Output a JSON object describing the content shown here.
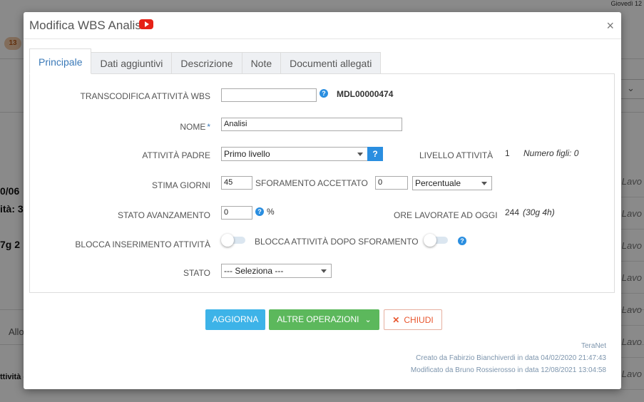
{
  "background": {
    "date_fragment": "Giovedì 12",
    "badge": "13",
    "text_fragments": [
      "0/06",
      "ità: 3",
      "7g 2",
      "Allo",
      "ttività e"
    ],
    "right_rows": [
      "S Lavo",
      "S Lavo",
      "S Lavo",
      "S Lavo",
      "S Lavo",
      "S Lavo",
      "S Lavo"
    ]
  },
  "modal": {
    "title": "Modifica WBS Analisi",
    "close_symbol": "×",
    "tabs": [
      {
        "label": "Principale",
        "active": true
      },
      {
        "label": "Dati aggiuntivi",
        "active": false
      },
      {
        "label": "Descrizione",
        "active": false
      },
      {
        "label": "Note",
        "active": false
      },
      {
        "label": "Documenti allegati",
        "active": false
      }
    ],
    "form": {
      "transcodifica_label": "TRANSCODIFICA ATTIVITÀ WBS",
      "transcodifica_value": "",
      "code": "MDL00000474",
      "nome_label": "NOME",
      "required_mark": "*",
      "nome_value": "Analisi",
      "attivita_padre_label": "ATTIVITÀ PADRE",
      "attivita_padre_value": "Primo livello",
      "help_btn_symbol": "?",
      "livello_label": "LIVELLO ATTIVITÀ",
      "livello_value": "1",
      "numero_figli": "Numero figli: 0",
      "stima_giorni_label": "STIMA GIORNI",
      "stima_giorni_value": "45",
      "sforamento_label": "SFORAMENTO ACCETTATO",
      "sforamento_value": "0",
      "sforamento_tipo": "Percentuale",
      "stato_avanzamento_label": "STATO AVANZAMENTO",
      "stato_avanzamento_value": "0",
      "percent_symbol": "%",
      "ore_lavorate_label": "ORE LAVORATE AD OGGI",
      "ore_lavorate_value": "244",
      "ore_lavorate_detail": "(30g 4h)",
      "blocca_inserimento_label": "BLOCCA INSERIMENTO ATTIVITÀ",
      "blocca_dopo_sforamento_label": "BLOCCA ATTIVITÀ DOPO SFORAMENTO",
      "stato_label": "STATO",
      "stato_value": "--- Seleziona ---"
    },
    "buttons": {
      "aggiorna": "AGGIORNA",
      "altre_operazioni": "ALTRE OPERAZIONI",
      "chiudi": "CHIUDI"
    },
    "footer": {
      "company": "TeraNet",
      "created": "Creato da Fabirzio Bianchiverdi in data 04/02/2020 21:47:43",
      "modified": "Modificato da Bruno Rossierosso in data 12/08/2021 13:04:58"
    }
  },
  "colors": {
    "accent_blue": "#3db3e8",
    "green": "#5cb85c",
    "danger": "#e8562e",
    "help_blue": "#2a8ee0"
  }
}
